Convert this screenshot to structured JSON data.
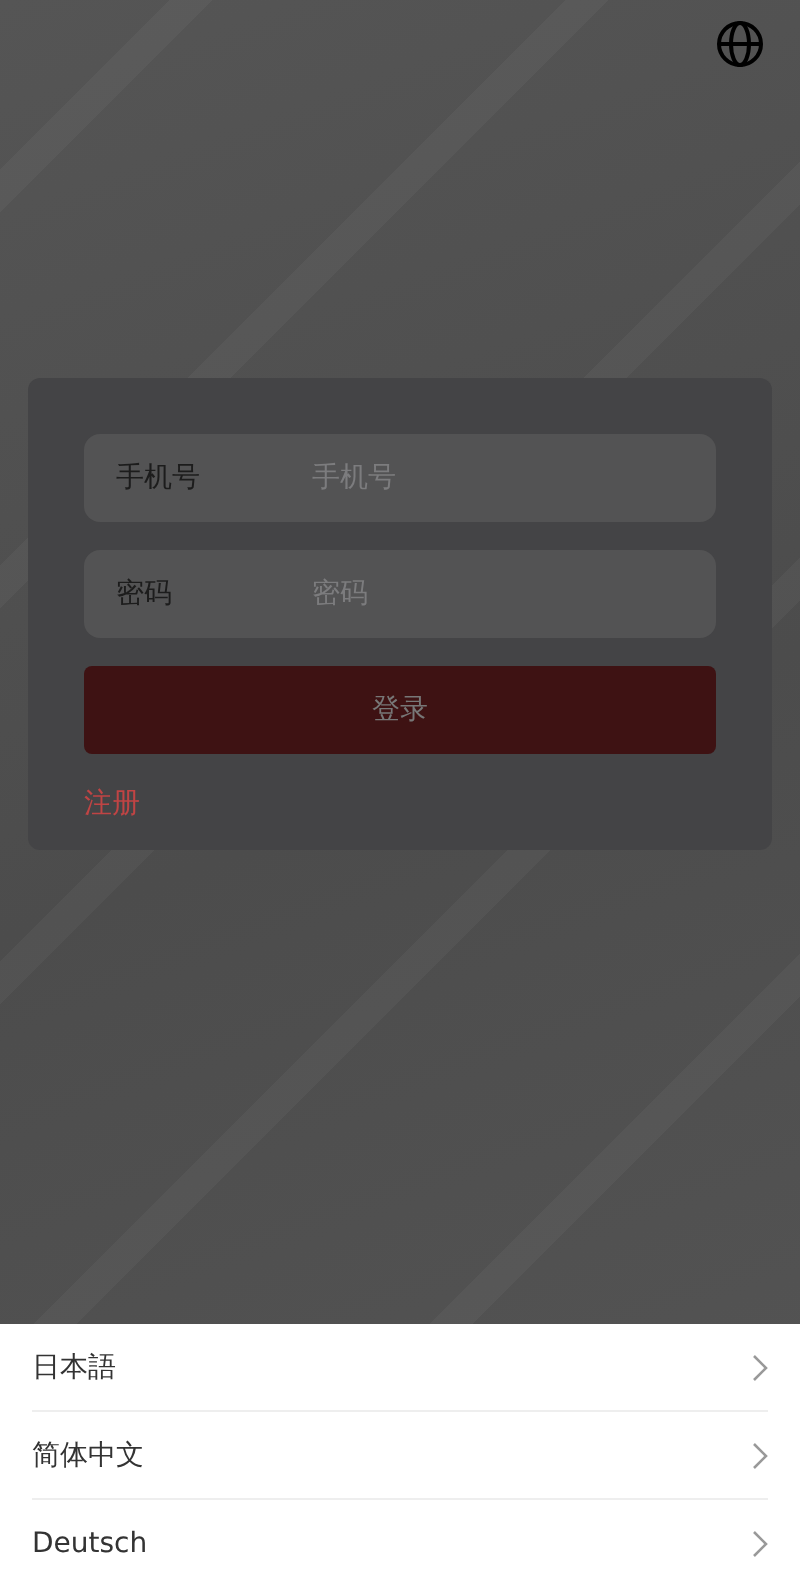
{
  "login_form": {
    "fields": [
      {
        "label": "手机号",
        "placeholder": "手机号"
      },
      {
        "label": "密码",
        "placeholder": "密码"
      }
    ],
    "submit_button": "登录",
    "register_link": "注册"
  },
  "language_sheet": {
    "options": [
      {
        "label": "日本語"
      },
      {
        "label": "简体中文"
      },
      {
        "label": "Deutsch"
      }
    ]
  }
}
